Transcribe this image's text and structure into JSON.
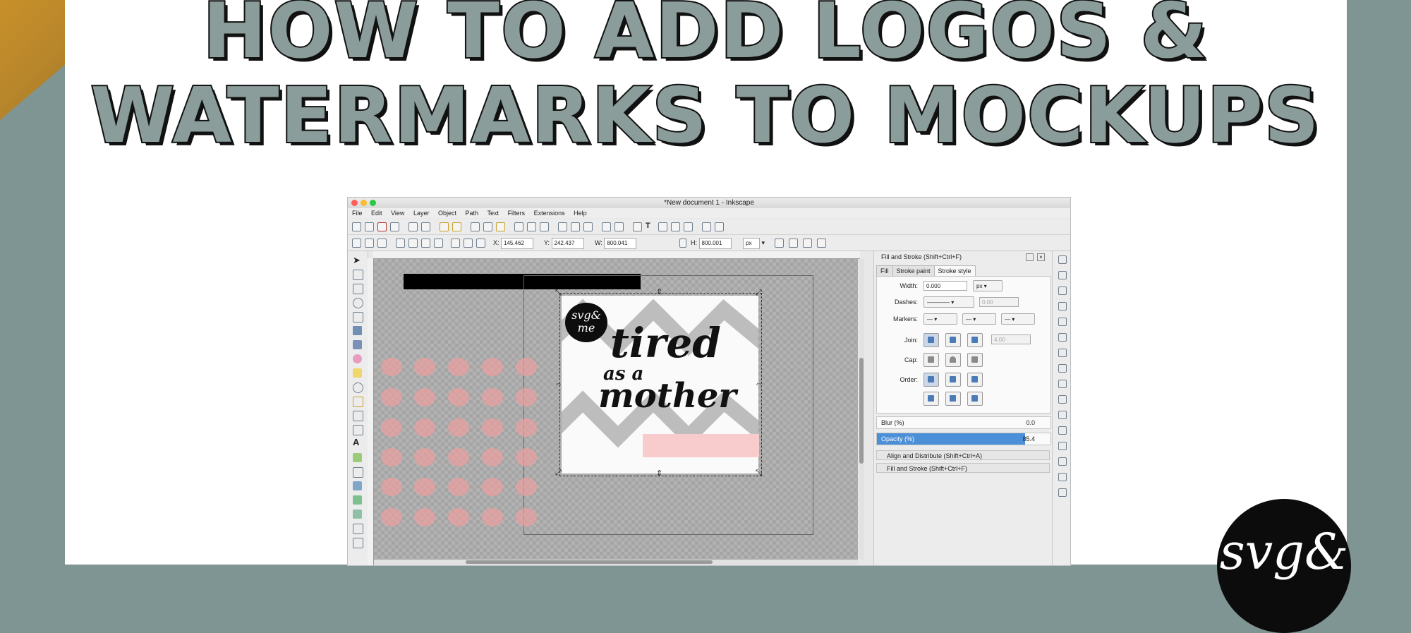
{
  "banner": {
    "line1": "HOW TO ADD LOGOS &",
    "line2": "WATERMARKS TO MOCKUPS"
  },
  "window": {
    "title": "*New document 1 - Inkscape"
  },
  "menu": [
    "File",
    "Edit",
    "View",
    "Layer",
    "Object",
    "Path",
    "Text",
    "Filters",
    "Extensions",
    "Help"
  ],
  "coords": {
    "x_label": "X:",
    "x": "145.462",
    "y_label": "Y:",
    "y": "242.437",
    "w_label": "W:",
    "w": "800.041",
    "h_label": "H:",
    "h": "800.001",
    "unit": "px"
  },
  "mockup": {
    "logo_text": "svg& me",
    "line1": "tired",
    "line2": "as a",
    "line3": "mother"
  },
  "panel": {
    "title": "Fill and Stroke (Shift+Ctrl+F)",
    "tabs": [
      "Fill",
      "Stroke paint",
      "Stroke style"
    ],
    "active_tab": "Stroke style",
    "width_label": "Width:",
    "width_value": "0.000",
    "width_unit": "px",
    "dashes_label": "Dashes:",
    "dashes_value": "0.00",
    "markers_label": "Markers:",
    "join_label": "Join:",
    "join_value": "4.00",
    "cap_label": "Cap:",
    "order_label": "Order:",
    "blur_label": "Blur (%)",
    "blur_value": "0.0",
    "opacity_label": "Opacity (%)",
    "opacity_value": "85.4",
    "opacity_fraction": 0.854,
    "dock1": "Align and Distribute (Shift+Ctrl+A)",
    "dock2": "Fill and Stroke (Shift+Ctrl+F)"
  },
  "brand_badge": "svg&",
  "colors": {
    "sage": "#7f9593",
    "title_fill": "#8a9d9a",
    "pink": "#f8cccc",
    "accent_blue": "#4a8fd8"
  }
}
